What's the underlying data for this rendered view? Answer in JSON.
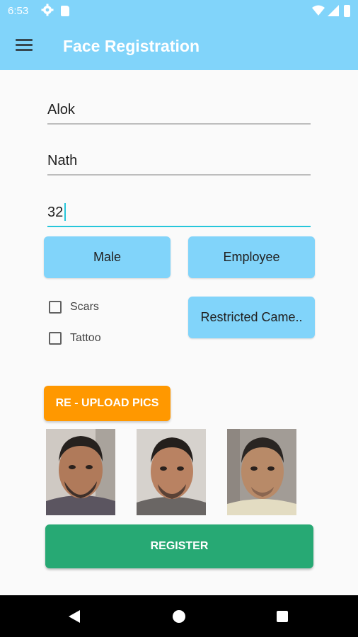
{
  "status_bar": {
    "time": "6:53",
    "icons": [
      "gear-icon",
      "sd-card-icon",
      "wifi-icon",
      "cell-signal-icon",
      "battery-icon"
    ]
  },
  "app_bar": {
    "title": "Face Registration",
    "menu_icon": "hamburger-menu-icon"
  },
  "form": {
    "first_name": "Alok",
    "last_name": "Nath",
    "age": "32",
    "gender_button": "Male",
    "type_button": "Employee",
    "camera_button": "Restricted Came..",
    "checkboxes": [
      {
        "label": "Scars",
        "checked": false
      },
      {
        "label": "Tattoo",
        "checked": false
      }
    ],
    "upload_button": "RE - UPLOAD PICS",
    "register_button": "REGISTER"
  },
  "photos": [
    "face-photo-1",
    "face-photo-2",
    "face-photo-3"
  ],
  "colors": {
    "app_bar": "#81d4fa",
    "option_button": "#81d4fa",
    "upload_button": "#ff9800",
    "register_button": "#27a974",
    "focus_line": "#26c6da"
  },
  "nav_bar": {
    "icons": [
      "back-icon",
      "home-icon",
      "recents-icon"
    ]
  }
}
